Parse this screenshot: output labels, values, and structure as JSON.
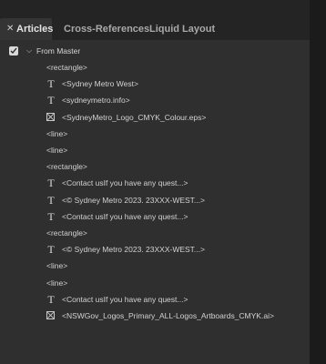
{
  "tabs": [
    {
      "label": "Articles",
      "active": true
    },
    {
      "label": "Cross-References",
      "active": false
    },
    {
      "label": "Liquid Layout",
      "active": false
    }
  ],
  "master": {
    "label": "From Master",
    "checked": true
  },
  "items": [
    {
      "type": "plain",
      "label": "<rectangle>"
    },
    {
      "type": "text",
      "label": "<Sydney Metro West>"
    },
    {
      "type": "text",
      "label": "<sydneymetro.info>"
    },
    {
      "type": "graphic",
      "label": "<SydneyMetro_Logo_CMYK_Colour.eps>"
    },
    {
      "type": "plain",
      "label": "<line>"
    },
    {
      "type": "plain",
      "label": "<line>"
    },
    {
      "type": "plain",
      "label": "<rectangle>"
    },
    {
      "type": "text",
      "label": "<Contact usIf you have any quest...>"
    },
    {
      "type": "text",
      "label": "<© Sydney Metro 2023.  23XXX-WEST...>"
    },
    {
      "type": "text",
      "label": "<Contact usIf you have any quest...>"
    },
    {
      "type": "plain",
      "label": "<rectangle>"
    },
    {
      "type": "text",
      "label": "<© Sydney Metro 2023.  23XXX-WEST...>"
    },
    {
      "type": "plain",
      "label": "<line>"
    },
    {
      "type": "plain",
      "label": "<line>"
    },
    {
      "type": "text",
      "label": "<Contact usIf you have any quest...>"
    },
    {
      "type": "graphic",
      "label": "<NSWGov_Logos_Primary_ALL-Logos_Artboards_CMYK.ai>"
    }
  ],
  "icons": {
    "text": "T",
    "graphic": "graphic-frame-icon"
  }
}
